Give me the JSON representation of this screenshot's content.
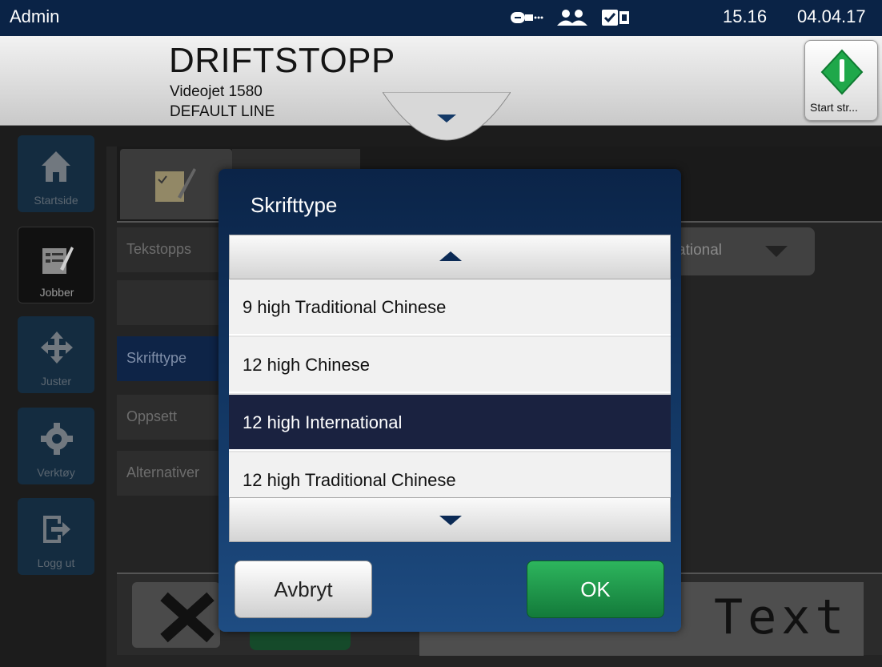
{
  "statusbar": {
    "user": "Admin",
    "time": "15.16",
    "date": "04.04.17",
    "icons": [
      "ink-cartridge-icon",
      "users-icon",
      "status-check-icon"
    ]
  },
  "header": {
    "state": "DRIFTSTOPP",
    "model": "Videojet 1580",
    "line": "DEFAULT LINE",
    "start_button_label": "Start str..."
  },
  "nav": {
    "items": [
      {
        "label": "Startside",
        "icon": "home-icon"
      },
      {
        "label": "Jobber",
        "icon": "jobs-icon"
      },
      {
        "label": "Juster",
        "icon": "move-icon"
      },
      {
        "label": "Verktøy",
        "icon": "gear-icon"
      },
      {
        "label": "Logg ut",
        "icon": "logout-icon"
      }
    ]
  },
  "background": {
    "rows": [
      "Tekstopps",
      "",
      "Skrifttype",
      "Oppsett",
      "Alternativer"
    ],
    "dropdown_value": "ational",
    "preview_text": "Text"
  },
  "dialog": {
    "title": "Skrifttype",
    "options": [
      "9 high Traditional Chinese",
      "12 high Chinese",
      "12 high International",
      "12 high Traditional Chinese"
    ],
    "selected_index": 2,
    "cancel_label": "Avbryt",
    "ok_label": "OK"
  },
  "colors": {
    "statusbar": "#0a2346",
    "dialog": "#143a68",
    "selected_option": "#1a2240",
    "ok_button": "#1f9a4a"
  }
}
